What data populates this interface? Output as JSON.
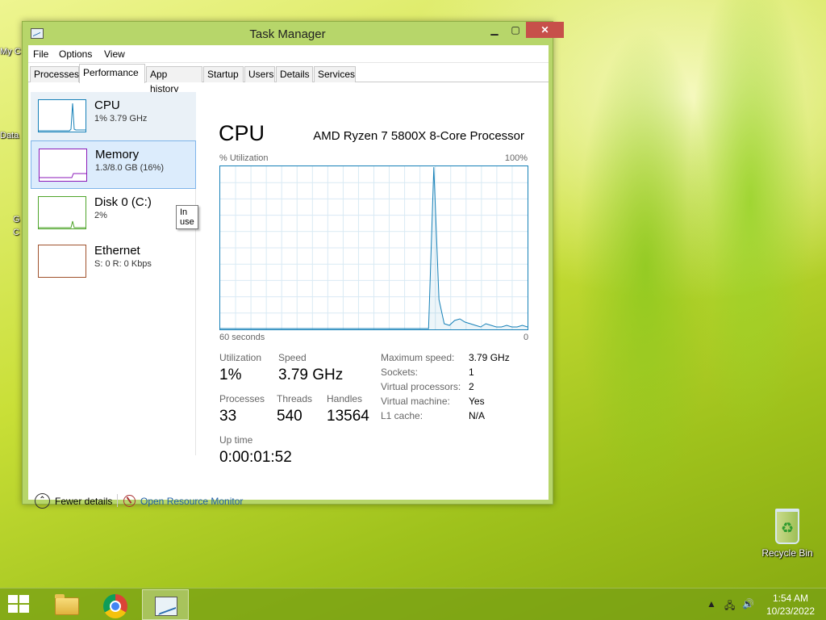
{
  "desktop": {
    "icons": [
      {
        "label": "My C"
      },
      {
        "label": "Data"
      },
      {
        "label": "G"
      },
      {
        "label": "C"
      }
    ],
    "recycle_bin": {
      "label": "Recycle Bin"
    }
  },
  "window": {
    "title": "Task Manager",
    "controls": {
      "minimize": "▁",
      "maximize": "▢",
      "close": "✕"
    },
    "menu": [
      "File",
      "Options",
      "View"
    ],
    "tabs": [
      "Processes",
      "Performance",
      "App history",
      "Startup",
      "Users",
      "Details",
      "Services"
    ],
    "selected_tab": "Performance"
  },
  "sidebar": {
    "items": [
      {
        "name": "CPU",
        "value": "1% 3.79 GHz",
        "color": "#1781b8"
      },
      {
        "name": "Memory",
        "value": "1.3/8.0 GB (16%)",
        "color": "#8b1ab8"
      },
      {
        "name": "Disk 0 (C:)",
        "value": "2%",
        "color": "#4fa52b"
      },
      {
        "name": "Ethernet",
        "value": "S: 0 R: 0 Kbps",
        "color": "#a0522d"
      }
    ],
    "tooltip": "In use"
  },
  "main": {
    "title": "CPU",
    "processor": "AMD Ryzen 7 5800X 8-Core Processor",
    "graph": {
      "y_label": "% Utilization",
      "y_max": "100%",
      "x_label": "60 seconds",
      "x_min": "0",
      "color": "#1781b8",
      "series": [
        0,
        0,
        0,
        0,
        0,
        0,
        0,
        0,
        0,
        0,
        0,
        0,
        0,
        0,
        0,
        0,
        0,
        0,
        0,
        0,
        0,
        0,
        0,
        0,
        0,
        0,
        0,
        0,
        0,
        0,
        0,
        0,
        0,
        0,
        0,
        0,
        0,
        0,
        0,
        0,
        0,
        100,
        18,
        3,
        2,
        5,
        6,
        4,
        3,
        2,
        1,
        3,
        2,
        1,
        1,
        2,
        1,
        1,
        2,
        1
      ]
    },
    "stats": {
      "utilization_label": "Utilization",
      "utilization": "1%",
      "speed_label": "Speed",
      "speed": "3.79 GHz",
      "processes_label": "Processes",
      "processes": "33",
      "threads_label": "Threads",
      "threads": "540",
      "handles_label": "Handles",
      "handles": "13564",
      "uptime_label": "Up time",
      "uptime": "0:00:01:52"
    },
    "details": [
      {
        "key": "Maximum speed:",
        "value": "3.79 GHz"
      },
      {
        "key": "Sockets:",
        "value": "1"
      },
      {
        "key": "Virtual processors:",
        "value": "2"
      },
      {
        "key": "Virtual machine:",
        "value": "Yes"
      },
      {
        "key": "L1 cache:",
        "value": "N/A"
      }
    ]
  },
  "footer": {
    "fewer_details": "Fewer details",
    "open_resource_monitor": "Open Resource Monitor"
  },
  "taskbar": {
    "time": "1:54 AM",
    "date": "10/23/2022"
  }
}
